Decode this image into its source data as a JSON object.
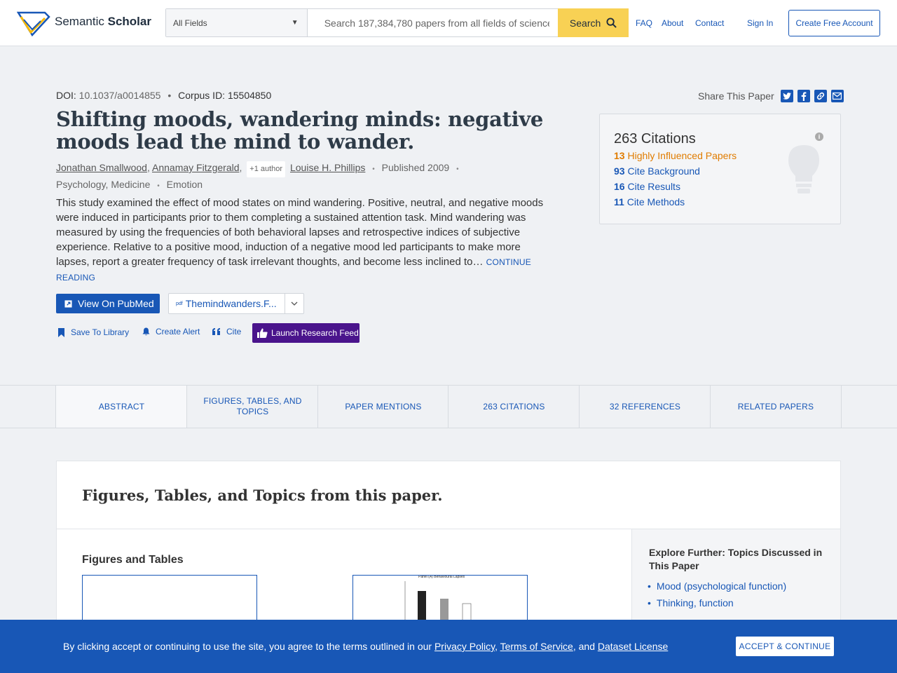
{
  "header": {
    "logo_name": "Semantic",
    "logo_name_bold": "Scholar",
    "field_select": "All Fields",
    "search_placeholder": "Search 187,384,780 papers from all fields of science",
    "search_button": "Search",
    "nav": [
      "FAQ",
      "About",
      "Contact"
    ],
    "sign_in": "Sign In",
    "create_account": "Create Free Account"
  },
  "paper": {
    "doi_label": "DOI:",
    "doi": "10.1037/a0014855",
    "corpus_label": "Corpus ID:",
    "corpus_id": "15504850",
    "title": "Shifting moods, wandering minds: negative moods lead the mind to wander.",
    "authors": [
      "Jonathan Smallwood",
      "Annamay Fitzgerald",
      "Louise H. Phillips"
    ],
    "more_authors": "+1 author",
    "published": "Published 2009",
    "fields": "Psychology, Medicine",
    "topic": "Emotion",
    "abstract": "This study examined the effect of mood states on mind wandering. Positive, neutral, and negative moods were induced in participants prior to them completing a sustained attention task. Mind wandering was measured by using the frequencies of both behavioral lapses and retrospective indices of subjective experience. Relative to a positive mood, induction of a negative mood led participants to make more lapses, report a greater frequency of task irrelevant thoughts, and become less inclined to…",
    "continue_reading": "CONTINUE READING",
    "pubmed_button": "View On PubMed",
    "pdf_source": "Themindwanders.F...",
    "pdf_icon_label": "pdf",
    "save": "Save To Library",
    "alert": "Create Alert",
    "cite": "Cite",
    "research_feed": "Launch Research Feed"
  },
  "share": {
    "label": "Share This Paper",
    "icons": [
      "twitter-icon",
      "facebook-icon",
      "link-icon",
      "email-icon"
    ]
  },
  "citations": {
    "title": "263 Citations",
    "rows": [
      {
        "count": "13",
        "label": "Highly Influenced Papers"
      },
      {
        "count": "93",
        "label": "Cite Background"
      },
      {
        "count": "16",
        "label": "Cite Results"
      },
      {
        "count": "11",
        "label": "Cite Methods"
      }
    ]
  },
  "tabs": [
    "Abstract",
    "Figures, Tables, and Topics",
    "Paper Mentions",
    "263 Citations",
    "32 References",
    "Related Papers"
  ],
  "figures_section": {
    "title": "Figures, Tables, and Topics from this paper.",
    "heading": "Figures and Tables",
    "figure2_caption": "Panel (A) Behavioural Lapses"
  },
  "explore": {
    "title": "Explore Further: Topics Discussed in This Paper",
    "topics": [
      "Mood (psychological function)",
      "Thinking, function"
    ]
  },
  "cookie": {
    "text_before": "By clicking accept or continuing to use the site, you agree to the terms outlined in our ",
    "privacy": "Privacy Policy",
    "sep1": ", ",
    "terms": "Terms of Service",
    "sep2": ", and ",
    "license": "Dataset License",
    "accept": "Accept & Continue"
  },
  "colors": {
    "primary": "#1857b6",
    "search_button": "#f8d154",
    "research_feed": "#4a148c",
    "highly_influenced": "#e07c00"
  }
}
